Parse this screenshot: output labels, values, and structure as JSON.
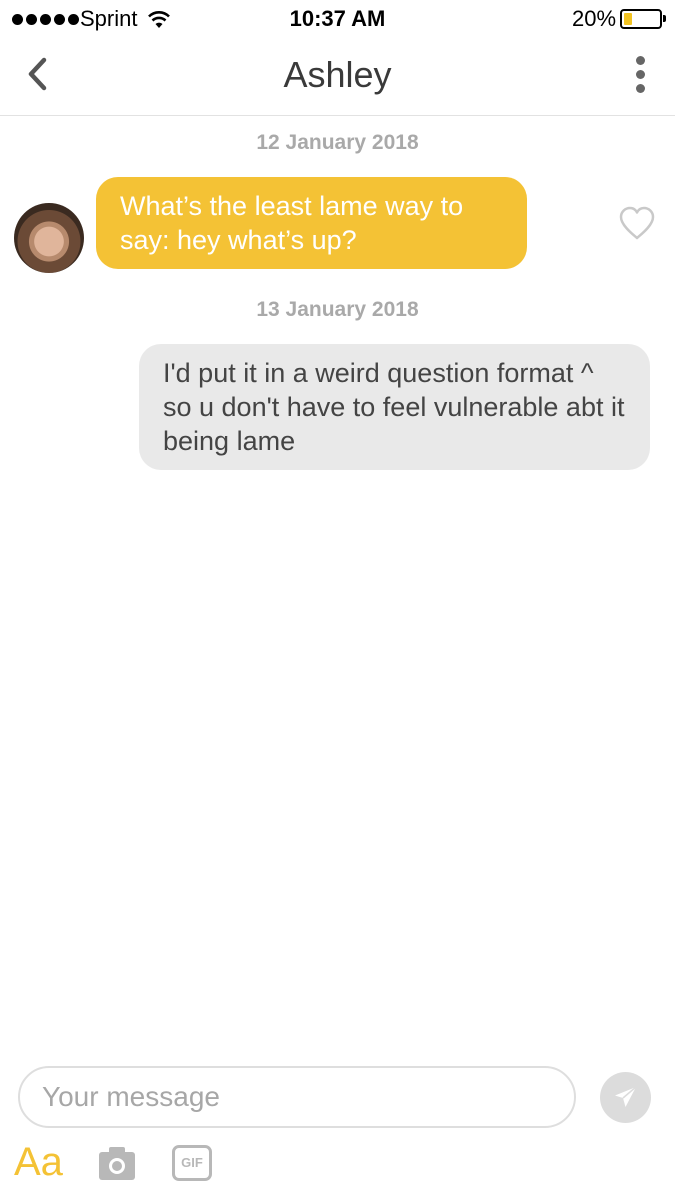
{
  "status_bar": {
    "carrier": "Sprint",
    "time": "10:37 AM",
    "battery_percent": "20%",
    "battery_level": 0.2,
    "icons": [
      "signal-dots-icon",
      "wifi-icon",
      "battery-icon"
    ]
  },
  "header": {
    "title": "Ashley",
    "back_icon": "chevron-left-icon",
    "more_icon": "more-vertical-icon"
  },
  "conversation": {
    "date_1": "12 January 2018",
    "incoming_message": "What’s the least lame way to say: hey what’s up?",
    "date_2": "13 January 2018",
    "outgoing_message": "I'd put it in a weird question format ^ so u don't have to feel vulnerable abt it being lame",
    "like_icon": "heart-outline-icon"
  },
  "composer": {
    "placeholder": "Your message",
    "value": "",
    "send_icon": "send-icon",
    "font_button_label": "Aa",
    "camera_icon": "camera-icon",
    "gif_label": "GIF"
  },
  "colors": {
    "accent": "#f4c235",
    "incoming_bubble": "#f4c235",
    "outgoing_bubble": "#e9e9e9",
    "date_text": "#a9a9a9"
  }
}
